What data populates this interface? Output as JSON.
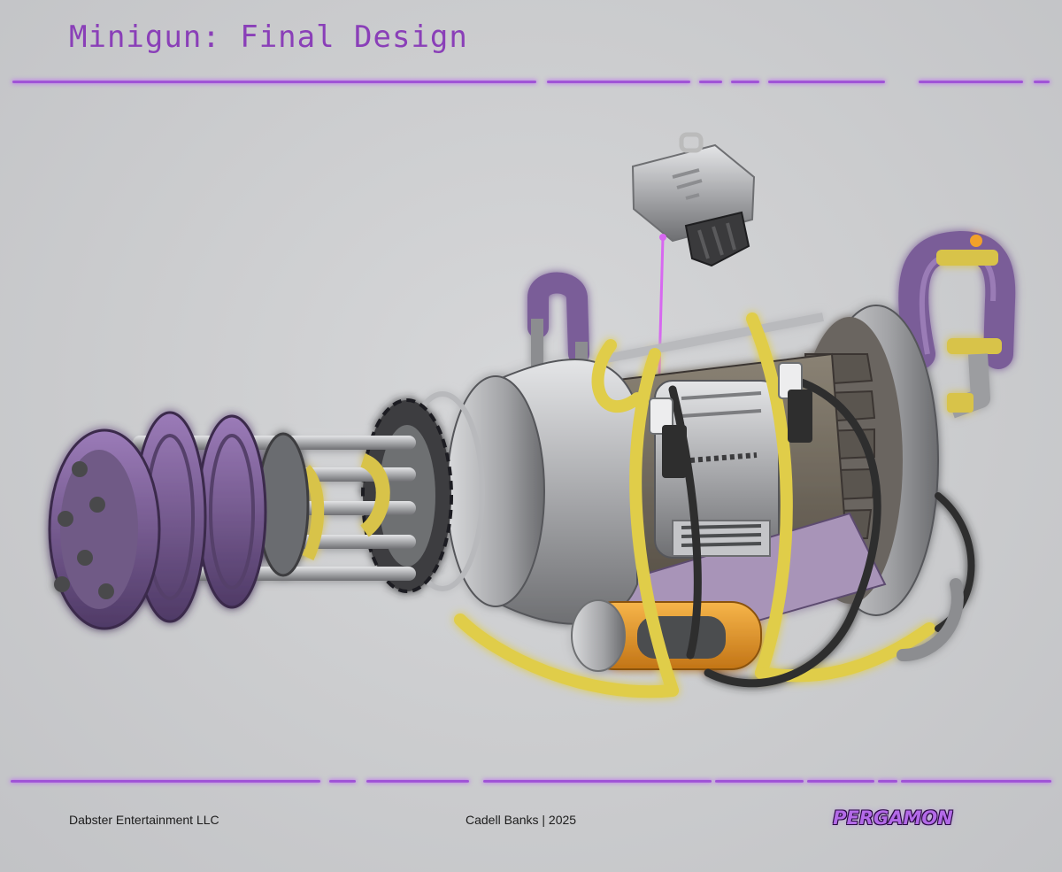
{
  "title": "Minigun: Final Design",
  "footer": {
    "company": "Dabster Entertainment LLC",
    "credit": "Cadell Banks | 2025",
    "logo_text": "PERGAMON"
  },
  "colors": {
    "accent_purple": "#8a3fb8",
    "glow_purple": "#c070f5",
    "tape_yellow": "#e6d44a",
    "metal_gray": "#a8a9ab",
    "barrel_purple": "#7b5a96"
  },
  "artwork": {
    "subject": "minigun-illustration",
    "callout": "ammo-clip"
  }
}
